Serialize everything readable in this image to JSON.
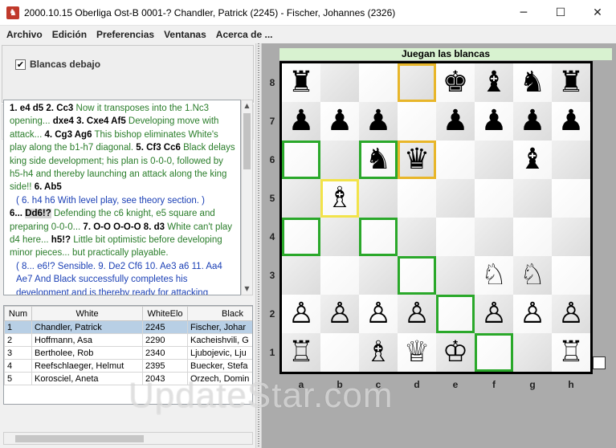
{
  "window": {
    "title": "2000.10.15 Oberliga Ost-B 0001-? Chandler, Patrick (2245) - Fischer, Johannes (2326)",
    "controls": [
      "─",
      "☐",
      "✕"
    ]
  },
  "menu": [
    "Archivo",
    "Edición",
    "Preferencias",
    "Ventanas",
    "Acerca de ..."
  ],
  "options": {
    "check_mark": "✔",
    "white_bottom_label": "Blancas debajo"
  },
  "nav": {
    "first": "⏮",
    "prev": "⏪",
    "next": "⏩",
    "last": "⏭"
  },
  "notation": [
    [
      [
        "mv",
        "1. "
      ],
      [
        "mv",
        "e4 d5"
      ],
      [
        "mv",
        " 2. "
      ],
      [
        "mv",
        "Cc3"
      ],
      [
        "c",
        " Now it transposes into the 1.Nc3 opening... "
      ],
      [
        "mv",
        "dxe4"
      ],
      [
        "mv",
        " 3. "
      ],
      [
        "mv",
        "Cxe4 Af5"
      ],
      [
        "c",
        " Developing move with attack... "
      ],
      [
        "mv",
        "4. Cg3 Ag6"
      ],
      [
        "c",
        " This bishop eliminates White's play along the b1-h7 diagonal. "
      ],
      [
        "mv",
        "5. Cf3 Cc6"
      ],
      [
        "c",
        " Black delays king side development; his plan is 0-0-0, followed by h5-h4 and thereby launching an attack along the king side!! "
      ],
      [
        "mv",
        "6. Ab5"
      ]
    ],
    [
      [
        "var",
        "( 6. h4 h6 With level play, see theory section. )"
      ]
    ],
    [
      [
        "mv",
        "6... "
      ],
      [
        "cur",
        "Dd6!?"
      ],
      [
        "c",
        " Defending the c6 knight, e5 square and preparing 0-0-0... "
      ],
      [
        "mv",
        "7. O-O O-O-O 8. d3"
      ],
      [
        "c",
        " White can't play d4 here... "
      ],
      [
        "mv",
        "h5!?"
      ],
      [
        "c",
        " Little bit optimistic before developing minor pieces... but practically playable."
      ]
    ],
    [
      [
        "var",
        "( 8... e6!? Sensible. 9. De2 Cf6 10. Ae3 a6 11. Aa4 Ae7 And Black successfully completes his development and is thereby ready for attacking"
      ]
    ]
  ],
  "games": {
    "columns": [
      "Num",
      "White",
      "WhiteElo",
      "Black"
    ],
    "rows": [
      [
        "1",
        "Chandler, Patrick",
        "2245",
        "Fischer, Johar"
      ],
      [
        "2",
        "Hoffmann, Asa",
        "2290",
        "Kacheishvili, G"
      ],
      [
        "3",
        "Bertholee, Rob",
        "2340",
        "Ljubojevic, Lju"
      ],
      [
        "4",
        "Reefschlaeger, Helmut",
        "2395",
        "Buecker, Stefa"
      ],
      [
        "5",
        "Korosciel, Aneta",
        "2043",
        "Orzech, Domin"
      ]
    ],
    "selected": 0
  },
  "board": {
    "turn_label": "Juegan las blancas",
    "ranks": [
      "8",
      "7",
      "6",
      "5",
      "4",
      "3",
      "2",
      "1"
    ],
    "files": [
      "a",
      "b",
      "c",
      "d",
      "e",
      "f",
      "g",
      "h"
    ],
    "position": [
      [
        "♜",
        "",
        "",
        "",
        "♚",
        "♝",
        "♞",
        "♜"
      ],
      [
        "♟",
        "♟",
        "♟",
        "",
        "♟",
        "♟",
        "♟",
        "♟"
      ],
      [
        "",
        "",
        "♞",
        "♛",
        "",
        "",
        "♝",
        ""
      ],
      [
        "",
        "♗",
        "",
        "",
        "",
        "",
        "",
        ""
      ],
      [
        "",
        "",
        "",
        "",
        "",
        "",
        "",
        ""
      ],
      [
        "",
        "",
        "",
        "",
        "",
        "♘",
        "♘",
        ""
      ],
      [
        "♙",
        "♙",
        "♙",
        "♙",
        "",
        "♙",
        "♙",
        "♙"
      ],
      [
        "♖",
        "",
        "♗",
        "♕",
        "♔",
        "",
        "",
        "♖"
      ]
    ],
    "highlights": [
      {
        "sq": "d8",
        "kind": "last-from"
      },
      {
        "sq": "d6",
        "kind": "last-to"
      },
      {
        "sq": "b5",
        "kind": "selected"
      },
      {
        "sq": "a6",
        "kind": "target"
      },
      {
        "sq": "c6",
        "kind": "target"
      },
      {
        "sq": "a4",
        "kind": "target"
      },
      {
        "sq": "c4",
        "kind": "target"
      },
      {
        "sq": "d3",
        "kind": "target"
      },
      {
        "sq": "e2",
        "kind": "target"
      },
      {
        "sq": "f1",
        "kind": "target"
      }
    ]
  },
  "watermark": "UpdateStar.com"
}
